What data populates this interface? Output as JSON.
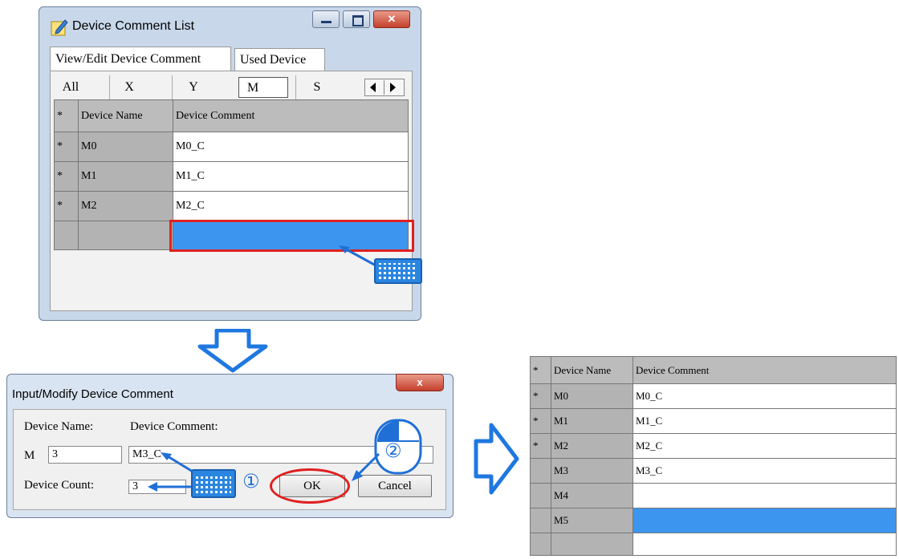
{
  "window1": {
    "title": "Device Comment List",
    "tabs": [
      "View/Edit Device Comment",
      "Used Device"
    ],
    "filters": [
      "All",
      "X",
      "Y",
      "M",
      "S"
    ],
    "selected_filter": "M",
    "grid": {
      "header": [
        "*",
        "Device Name",
        "Device Comment"
      ],
      "rows": [
        {
          "mark": "*",
          "name": "M0",
          "comment": "M0_C"
        },
        {
          "mark": "*",
          "name": "M1",
          "comment": "M1_C"
        },
        {
          "mark": "*",
          "name": "M2",
          "comment": "M2_C"
        }
      ]
    }
  },
  "dialog": {
    "title": "Input/Modify Device Comment",
    "close_label": "x",
    "device_name_label": "Device Name:",
    "device_comment_label": "Device Comment:",
    "device_prefix": "M",
    "device_number": "3",
    "device_comment_value": "M3_C",
    "device_count_label": "Device Count:",
    "device_count_value": "3",
    "ok_label": "OK",
    "cancel_label": "Cancel",
    "step1": "①",
    "step2": "②"
  },
  "result_grid": {
    "header": [
      "*",
      "Device Name",
      "Device Comment"
    ],
    "rows": [
      {
        "mark": "*",
        "name": "M0",
        "comment": "M0_C"
      },
      {
        "mark": "*",
        "name": "M1",
        "comment": "M1_C"
      },
      {
        "mark": "*",
        "name": "M2",
        "comment": "M2_C"
      },
      {
        "mark": "",
        "name": "M3",
        "comment": "M3_C"
      },
      {
        "mark": "",
        "name": "M4",
        "comment": ""
      },
      {
        "mark": "",
        "name": "M5",
        "comment": ""
      },
      {
        "mark": "",
        "name": "",
        "comment": ""
      }
    ]
  },
  "colors": {
    "accent_blue": "#3c96f0",
    "highlight_red": "#e02020",
    "arrow_blue": "#1f6fd6"
  }
}
